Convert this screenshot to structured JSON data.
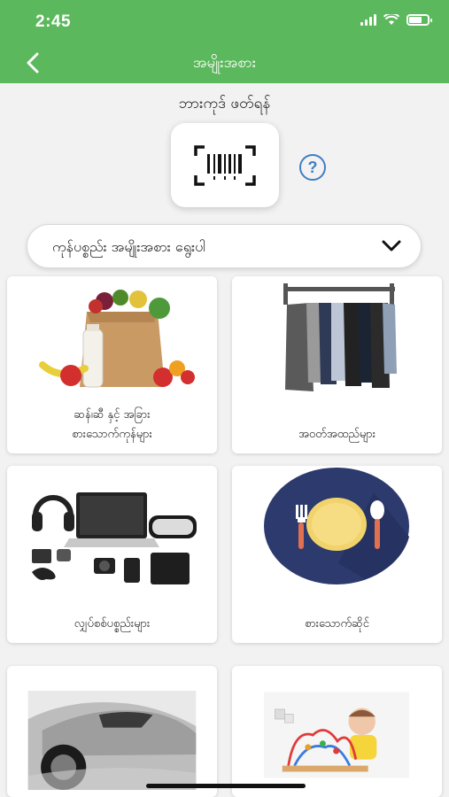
{
  "status_bar": {
    "time": "2:45"
  },
  "nav": {
    "title": "အမျိုးအစား"
  },
  "scan": {
    "label": "ဘားကုဒ် ဖတ်ရန်",
    "help_symbol": "?"
  },
  "category_select": {
    "value": "ကုန်ပစ္စည်း အမျိုးအစား ရွေးပါ"
  },
  "categories": [
    {
      "label": "ဆန်၊ဆီ နှင့် အခြား\nစားသောက်ကုန်များ",
      "icon": "grocery-bag-image"
    },
    {
      "label": "အဝတ်အထည်များ",
      "icon": "clothes-rack-image"
    },
    {
      "label": "လျှပ်စစ်ပစ္စည်းများ",
      "icon": "electronics-image"
    },
    {
      "label": "စားသောက်ဆိုင်",
      "icon": "restaurant-plate-image"
    },
    {
      "label": "",
      "icon": "car-image"
    },
    {
      "label": "",
      "icon": "baby-toy-image"
    }
  ],
  "colors": {
    "header": "#5cb85c",
    "help": "#3f7fc4",
    "plate_bg": "#2d3a6e",
    "plate": "#f2d36b"
  }
}
